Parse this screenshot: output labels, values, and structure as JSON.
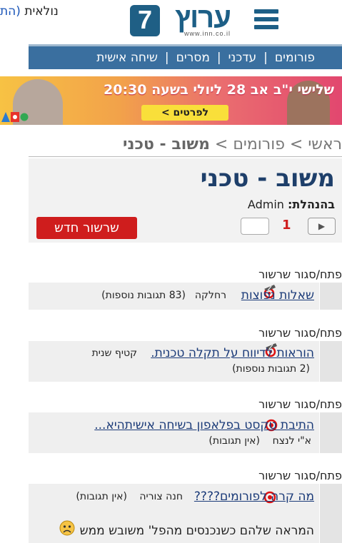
{
  "header": {
    "cut_text_main": "נולאית ",
    "cut_text_link": "(הת",
    "logo_word": "ערוץ",
    "logo_number": "7",
    "logo_url": "www.inn.co.il"
  },
  "nav": {
    "items": [
      "פורומים",
      "עדכני",
      "מסרים",
      "שיחה אישית"
    ]
  },
  "banner": {
    "text": "שלישי י\"ב אב 28 ליולי בשעה 20:30",
    "button_label": "לפרטים >"
  },
  "breadcrumb": {
    "home": "ראשי",
    "forums": "פורומים",
    "current": "משוב - טכני",
    "sep": " > "
  },
  "forum": {
    "title": "משוב - טכני",
    "moderation_label": "בהנהלת:",
    "moderator": "Admin",
    "new_thread_label": "שרשור חדש",
    "current_page": "1",
    "next_symbol": "▶"
  },
  "toggle_label": "פתח/סגור שרשור",
  "threads": [
    {
      "title": "שאלות נפוצות",
      "author": "רחלקה",
      "replies": "(83 תגובות נוספות)"
    },
    {
      "title": "הוראות לדיווח על תקלה טכנית.",
      "author": "קטיף שנית",
      "replies": "(2 תגובות נוספות)"
    },
    {
      "title": "התיבת טקסט בפלאפון בשיחה אישיתהיא...",
      "author": "א\"י לנצח",
      "replies": "(אין תגובות)"
    },
    {
      "title": "מה קרה לפורומים????",
      "author": "חנה צוריה",
      "replies": "(אין תגובות)",
      "snippet": "המראה שלהם כשנכנסים מהפל' משובש ממש"
    }
  ],
  "colors": {
    "nav_bg": "#3a6f9f",
    "title_blue": "#1e3f6a",
    "link_blue": "#1a3a78",
    "new_button_red": "#cf1d1d"
  }
}
